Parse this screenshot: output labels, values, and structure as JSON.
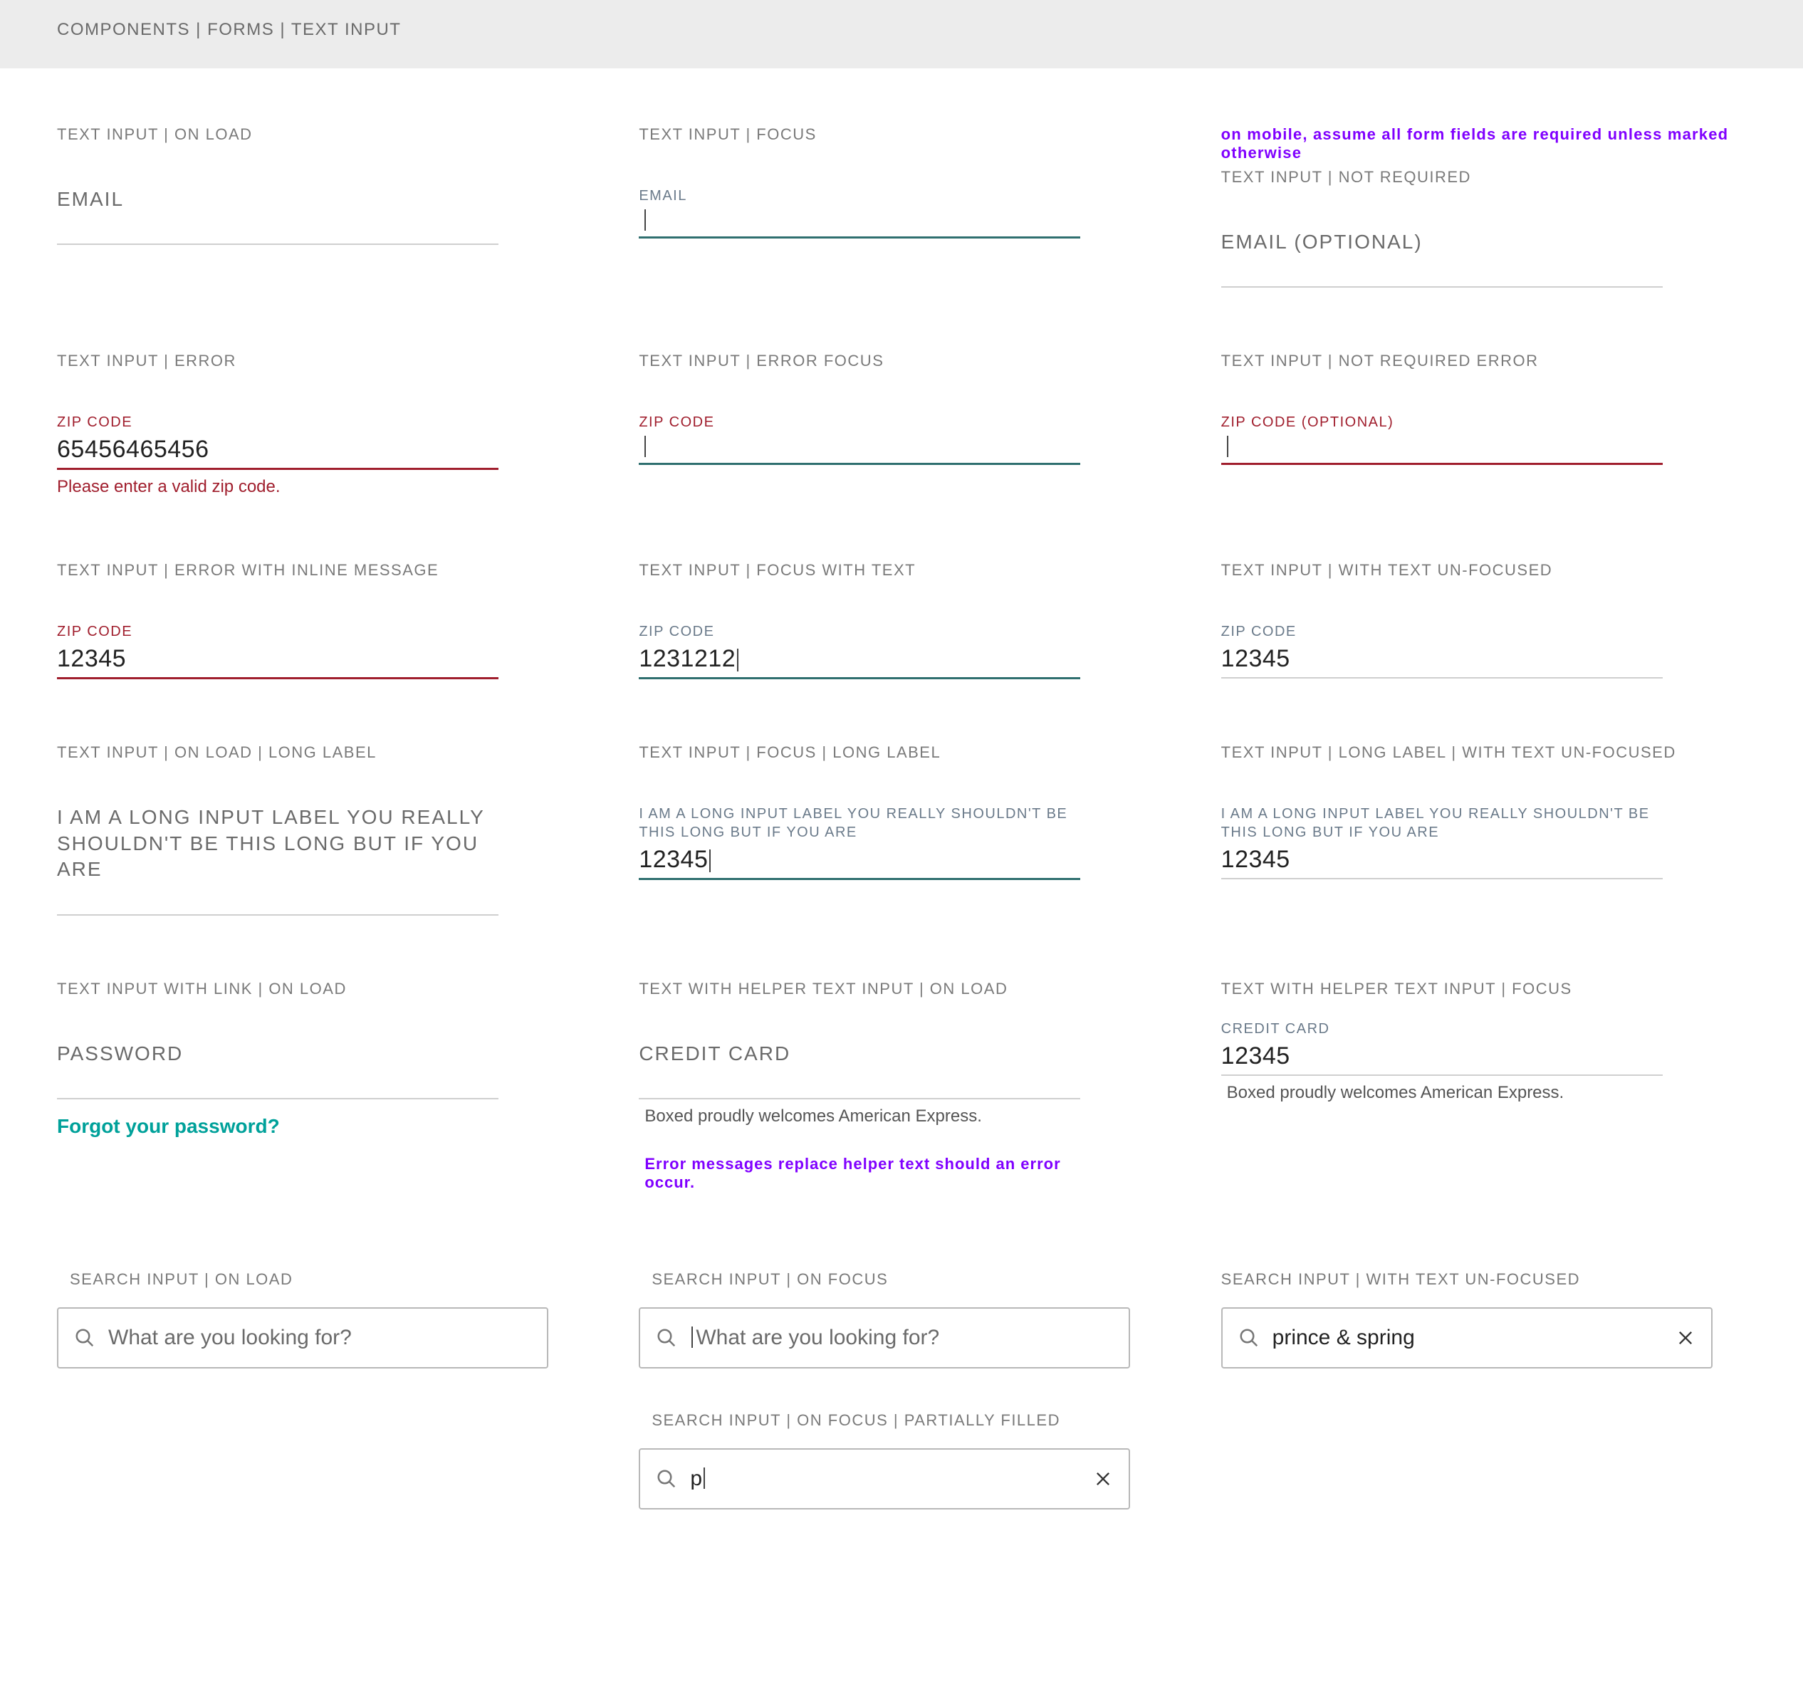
{
  "breadcrumb": "COMPONENTS | FORMS | TEXT INPUT",
  "mobile_note": "on mobile, assume all form fields are required unless marked otherwise",
  "inputs": {
    "onload": {
      "heading": "TEXT INPUT | ON LOAD",
      "label": "EMAIL"
    },
    "focus": {
      "heading": "TEXT INPUT | FOCUS",
      "label": "EMAIL"
    },
    "not_required": {
      "heading": "TEXT INPUT | NOT REQUIRED",
      "label": "EMAIL (OPTIONAL)"
    },
    "error": {
      "heading": "TEXT INPUT | ERROR",
      "label": "ZIP CODE",
      "value": "65456465456",
      "error": "Please enter a valid zip code."
    },
    "error_focus": {
      "heading": "TEXT INPUT | ERROR FOCUS",
      "label": "ZIP CODE"
    },
    "not_required_error": {
      "heading": "TEXT INPUT | NOT REQUIRED ERROR",
      "label": "ZIP CODE (OPTIONAL)"
    },
    "error_inline": {
      "heading": "TEXT INPUT | ERROR WITH INLINE MESSAGE",
      "label": "ZIP CODE",
      "value": "12345"
    },
    "focus_with_text": {
      "heading": "TEXT INPUT | FOCUS WITH TEXT",
      "label": "ZIP CODE",
      "value": "1231212"
    },
    "with_text_unfocused": {
      "heading": "TEXT INPUT | WITH TEXT UN-FOCUSED",
      "label": "ZIP CODE",
      "value": "12345"
    },
    "onload_long": {
      "heading": "TEXT INPUT | ON LOAD | LONG LABEL",
      "label": "I AM A LONG INPUT LABEL YOU REALLY SHOULDN'T BE THIS LONG BUT IF YOU ARE"
    },
    "focus_long": {
      "heading": "TEXT INPUT | FOCUS | LONG LABEL",
      "label": "I AM A LONG INPUT LABEL YOU REALLY SHOULDN'T BE THIS LONG BUT IF YOU ARE",
      "value": "12345"
    },
    "long_unfocused": {
      "heading": "TEXT INPUT | LONG LABEL | WITH TEXT UN-FOCUSED",
      "label": "I AM A LONG INPUT LABEL YOU REALLY SHOULDN'T BE THIS LONG BUT IF YOU ARE",
      "value": "12345"
    },
    "with_link": {
      "heading": "TEXT INPUT WITH LINK | ON LOAD",
      "label": "PASSWORD",
      "link": "Forgot your password?"
    },
    "helper_onload": {
      "heading": "TEXT WITH HELPER TEXT INPUT | ON LOAD",
      "label": "CREDIT CARD",
      "helper": "Boxed proudly welcomes American Express.",
      "note": "Error messages replace helper text should an error occur."
    },
    "helper_focus": {
      "heading": "TEXT WITH HELPER TEXT INPUT | FOCUS",
      "label": "CREDIT CARD",
      "value": "12345",
      "helper": "Boxed proudly welcomes American Express."
    }
  },
  "search": {
    "onload": {
      "heading": "SEARCH INPUT | ON LOAD",
      "placeholder": "What are you looking for?"
    },
    "onfocus": {
      "heading": "SEARCH INPUT | ON FOCUS",
      "placeholder": "What are you looking for?"
    },
    "unfocused_text": {
      "heading": "SEARCH INPUT | WITH TEXT UN-FOCUSED",
      "value": "prince & spring"
    },
    "partial": {
      "heading": "SEARCH INPUT | ON FOCUS | PARTIALLY FILLED",
      "value": "p"
    }
  }
}
